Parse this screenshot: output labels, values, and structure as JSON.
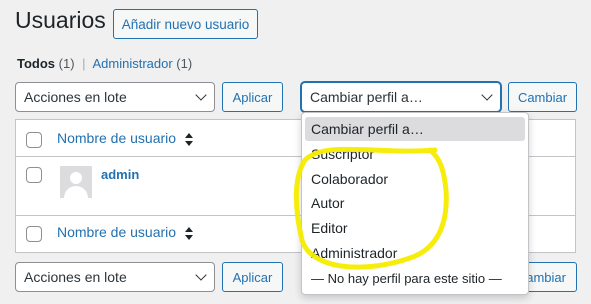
{
  "page": {
    "title": "Usuarios",
    "add_button": "Añadir nuevo usuario"
  },
  "filters": {
    "all_label": "Todos",
    "all_count": "(1)",
    "admin_label": "Administrador",
    "admin_count": "(1)"
  },
  "top_actions": {
    "bulk_select": "Acciones en lote",
    "apply_button": "Aplicar",
    "role_select": "Cambiar perfil a…",
    "change_button": "Cambiar"
  },
  "table": {
    "column_username": "Nombre de usuario",
    "rows": [
      {
        "username": "admin"
      }
    ]
  },
  "bottom_actions": {
    "bulk_select": "Acciones en lote",
    "apply_button": "Aplicar",
    "change_button_partial": "ambiar"
  },
  "role_dropdown": {
    "options": [
      "Cambiar perfil a…",
      "Suscriptor",
      "Colaborador",
      "Autor",
      "Editor",
      "Administrador",
      "— No hay perfil para este sitio —"
    ],
    "selected_index": 0
  },
  "annotation": {
    "highlight_color": "#f5ec00"
  },
  "colors": {
    "link": "#2271b1",
    "background": "#f0f0f1"
  }
}
